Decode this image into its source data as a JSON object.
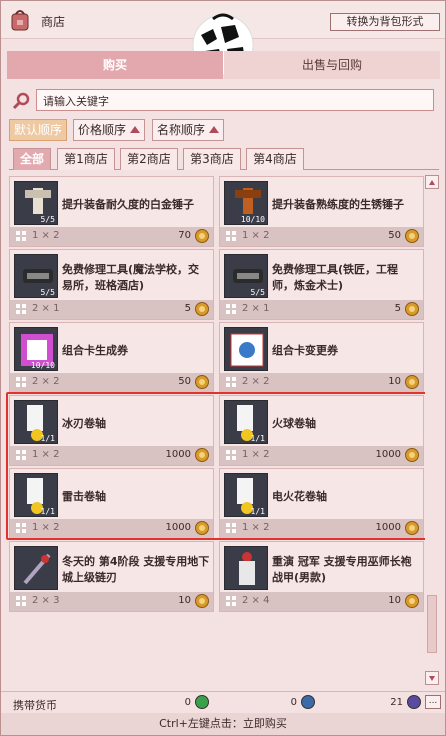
{
  "window": {
    "title": "商店",
    "switch_label": "转换为背包形式"
  },
  "main_tabs": [
    "购买",
    "出售与回购"
  ],
  "search": {
    "placeholder": "请输入关键字"
  },
  "sort_buttons": [
    "默认顺序",
    "价格顺序",
    "名称顺序"
  ],
  "sub_tabs": [
    "全部",
    "第1商店",
    "第2商店",
    "第3商店",
    "第4商店"
  ],
  "items": [
    {
      "name": "提升装备耐久度的白金锤子",
      "size": "1 × 2",
      "price": "70",
      "qty": "5/5",
      "icon": "platinum-hammer-icon"
    },
    {
      "name": "提升装备熟练度的生锈锤子",
      "size": "1 × 2",
      "price": "50",
      "qty": "10/10",
      "icon": "rusty-hammer-icon"
    },
    {
      "name": "免费修理工具(魔法学校，交易所，班格酒店)",
      "size": "2 × 1",
      "price": "5",
      "qty": "5/5",
      "icon": "repair-tool-icon"
    },
    {
      "name": "免费修理工具(铁匠，工程师，炼金术士)",
      "size": "2 × 1",
      "price": "5",
      "qty": "5/5",
      "icon": "repair-tool-icon"
    },
    {
      "name": "组合卡生成券",
      "size": "2 × 2",
      "price": "50",
      "qty": "10/10",
      "icon": "card-ticket-icon"
    },
    {
      "name": "组合卡变更券",
      "size": "2 × 2",
      "price": "10",
      "qty": "",
      "icon": "card-change-icon"
    },
    {
      "name": "冰刃卷轴",
      "size": "1 × 2",
      "price": "1000",
      "qty": "1/1",
      "icon": "scroll-icon"
    },
    {
      "name": "火球卷轴",
      "size": "1 × 2",
      "price": "1000",
      "qty": "1/1",
      "icon": "scroll-icon"
    },
    {
      "name": "雷击卷轴",
      "size": "1 × 2",
      "price": "1000",
      "qty": "1/1",
      "icon": "scroll-icon"
    },
    {
      "name": "电火花卷轴",
      "size": "1 × 2",
      "price": "1000",
      "qty": "1/1",
      "icon": "scroll-icon"
    },
    {
      "name": "冬天的 第4阶段 支援专用地下城上级链刃",
      "size": "2 × 3",
      "price": "10",
      "qty": "",
      "icon": "chain-blade-icon"
    },
    {
      "name": "重演 冠军 支援专用巫师长袍战甲(男款)",
      "size": "2 × 4",
      "price": "10",
      "qty": "",
      "icon": "robe-icon"
    }
  ],
  "currency": {
    "label": "携带货币",
    "values": [
      "0",
      "0",
      "21"
    ],
    "more_label": "..."
  },
  "hint": "Ctrl+左键点击：立即购买",
  "colors": {
    "accent": "#e2a9ae",
    "highlight": "#e3322e",
    "coin": "#d89a2c"
  }
}
